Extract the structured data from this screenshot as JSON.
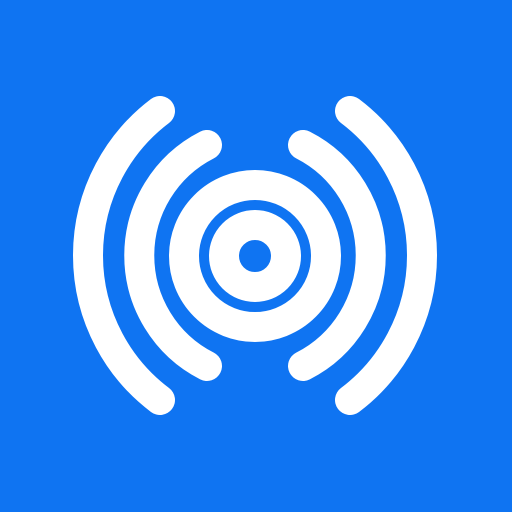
{
  "app_icon": {
    "icon_name": "broadcast-signal-icon",
    "background_color": "#0F74F2",
    "foreground_color": "#FFFFFF"
  }
}
